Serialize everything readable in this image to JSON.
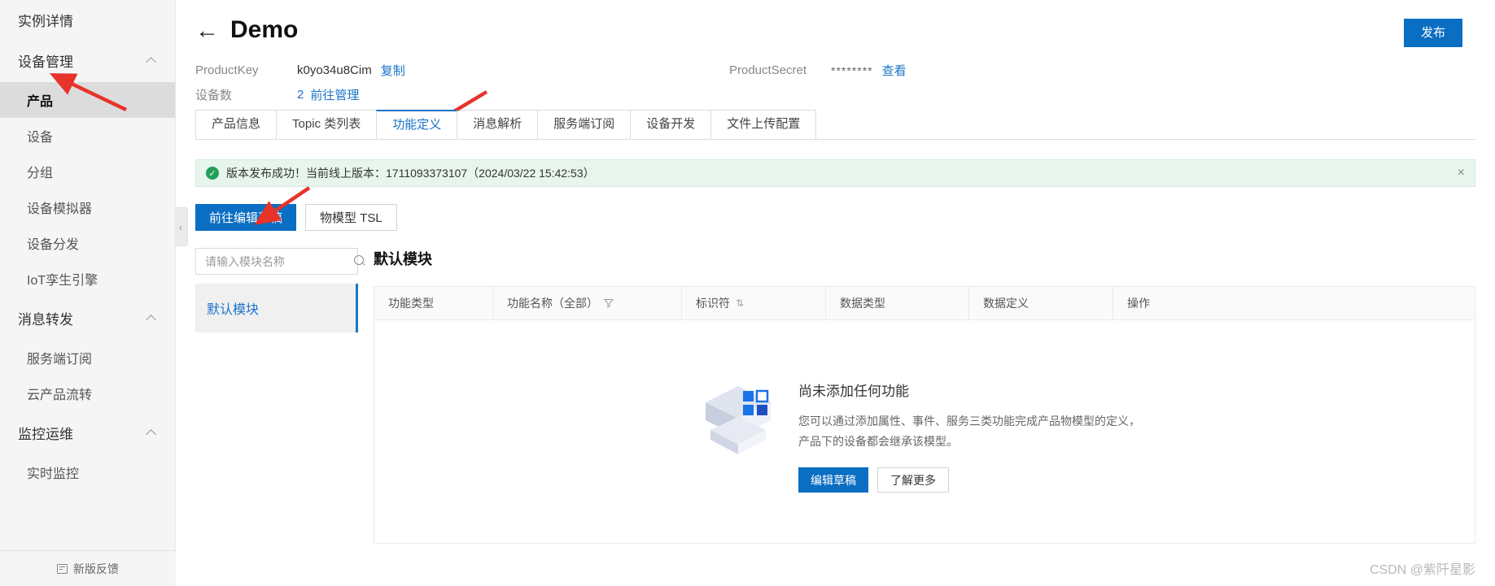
{
  "sidebar": {
    "items": [
      {
        "label": "实例详情",
        "type": "top",
        "name": "instance-detail"
      },
      {
        "label": "设备管理",
        "type": "group",
        "name": "device-management",
        "expanded": true
      },
      {
        "label": "产品",
        "type": "sub",
        "name": "product",
        "active": true
      },
      {
        "label": "设备",
        "type": "sub",
        "name": "device"
      },
      {
        "label": "分组",
        "type": "sub",
        "name": "group"
      },
      {
        "label": "设备模拟器",
        "type": "sub",
        "name": "device-simulator"
      },
      {
        "label": "设备分发",
        "type": "sub",
        "name": "device-distribution"
      },
      {
        "label": "IoT孪生引擎",
        "type": "sub",
        "name": "iot-twin-engine"
      },
      {
        "label": "消息转发",
        "type": "group",
        "name": "message-forwarding",
        "expanded": true
      },
      {
        "label": "服务端订阅",
        "type": "sub",
        "name": "server-subscription"
      },
      {
        "label": "云产品流转",
        "type": "sub",
        "name": "cloud-product-flow"
      },
      {
        "label": "监控运维",
        "type": "group",
        "name": "monitor-ops",
        "expanded": true
      },
      {
        "label": "实时监控",
        "type": "sub",
        "name": "realtime-monitor"
      }
    ],
    "footer_label": "新版反馈"
  },
  "header": {
    "back_icon": "←",
    "title": "Demo",
    "publish_label": "发布"
  },
  "meta": {
    "product_key_label": "ProductKey",
    "product_key_value": "k0yo34u8Cim",
    "product_key_copy": "复制",
    "device_count_label": "设备数",
    "device_count_value": "2",
    "device_count_link": "前往管理",
    "product_secret_label": "ProductSecret",
    "product_secret_value": "********",
    "product_secret_view": "查看"
  },
  "tabs": [
    {
      "label": "产品信息",
      "name": "tab-product-info",
      "active": false
    },
    {
      "label": "Topic 类列表",
      "name": "tab-topic-list",
      "active": false
    },
    {
      "label": "功能定义",
      "name": "tab-function-definition",
      "active": true
    },
    {
      "label": "消息解析",
      "name": "tab-message-parsing",
      "active": false
    },
    {
      "label": "服务端订阅",
      "name": "tab-server-subscription",
      "active": false
    },
    {
      "label": "设备开发",
      "name": "tab-device-development",
      "active": false
    },
    {
      "label": "文件上传配置",
      "name": "tab-file-upload-config",
      "active": false
    }
  ],
  "alert": {
    "icon": "check-circle-icon",
    "message": "版本发布成功！当前线上版本：1711093373107（2024/03/22 15:42:53）",
    "close_icon": "×"
  },
  "actions": {
    "edit_draft_label": "前往编辑草稿",
    "tsl_label": "物模型 TSL"
  },
  "search": {
    "placeholder": "请输入模块名称",
    "value": ""
  },
  "modules": [
    {
      "label": "默认模块",
      "active": true
    }
  ],
  "table": {
    "title": "默认模块",
    "columns": [
      {
        "label": "功能类型",
        "name": "col-function-type",
        "icon": ""
      },
      {
        "label": "功能名称（全部）",
        "name": "col-function-name",
        "icon": "filter-icon"
      },
      {
        "label": "标识符",
        "name": "col-identifier",
        "icon": "sort-icon"
      },
      {
        "label": "数据类型",
        "name": "col-data-type",
        "icon": ""
      },
      {
        "label": "数据定义",
        "name": "col-data-definition",
        "icon": ""
      },
      {
        "label": "操作",
        "name": "col-operation",
        "icon": ""
      }
    ],
    "rows": [],
    "empty": {
      "title": "尚未添加任何功能",
      "description": "您可以通过添加属性、事件、服务三类功能完成产品物模型的定义，产品下的设备都会继承该模型。",
      "primary_label": "编辑草稿",
      "secondary_label": "了解更多"
    }
  },
  "collapse_handle_icon": "‹",
  "watermark": "CSDN @紫阡星影",
  "colors": {
    "primary": "#0a6ec3",
    "link": "#1a73c8",
    "success_bg": "#e7f5ec",
    "success_icon": "#22a05a",
    "annotation": "#e8332a"
  }
}
